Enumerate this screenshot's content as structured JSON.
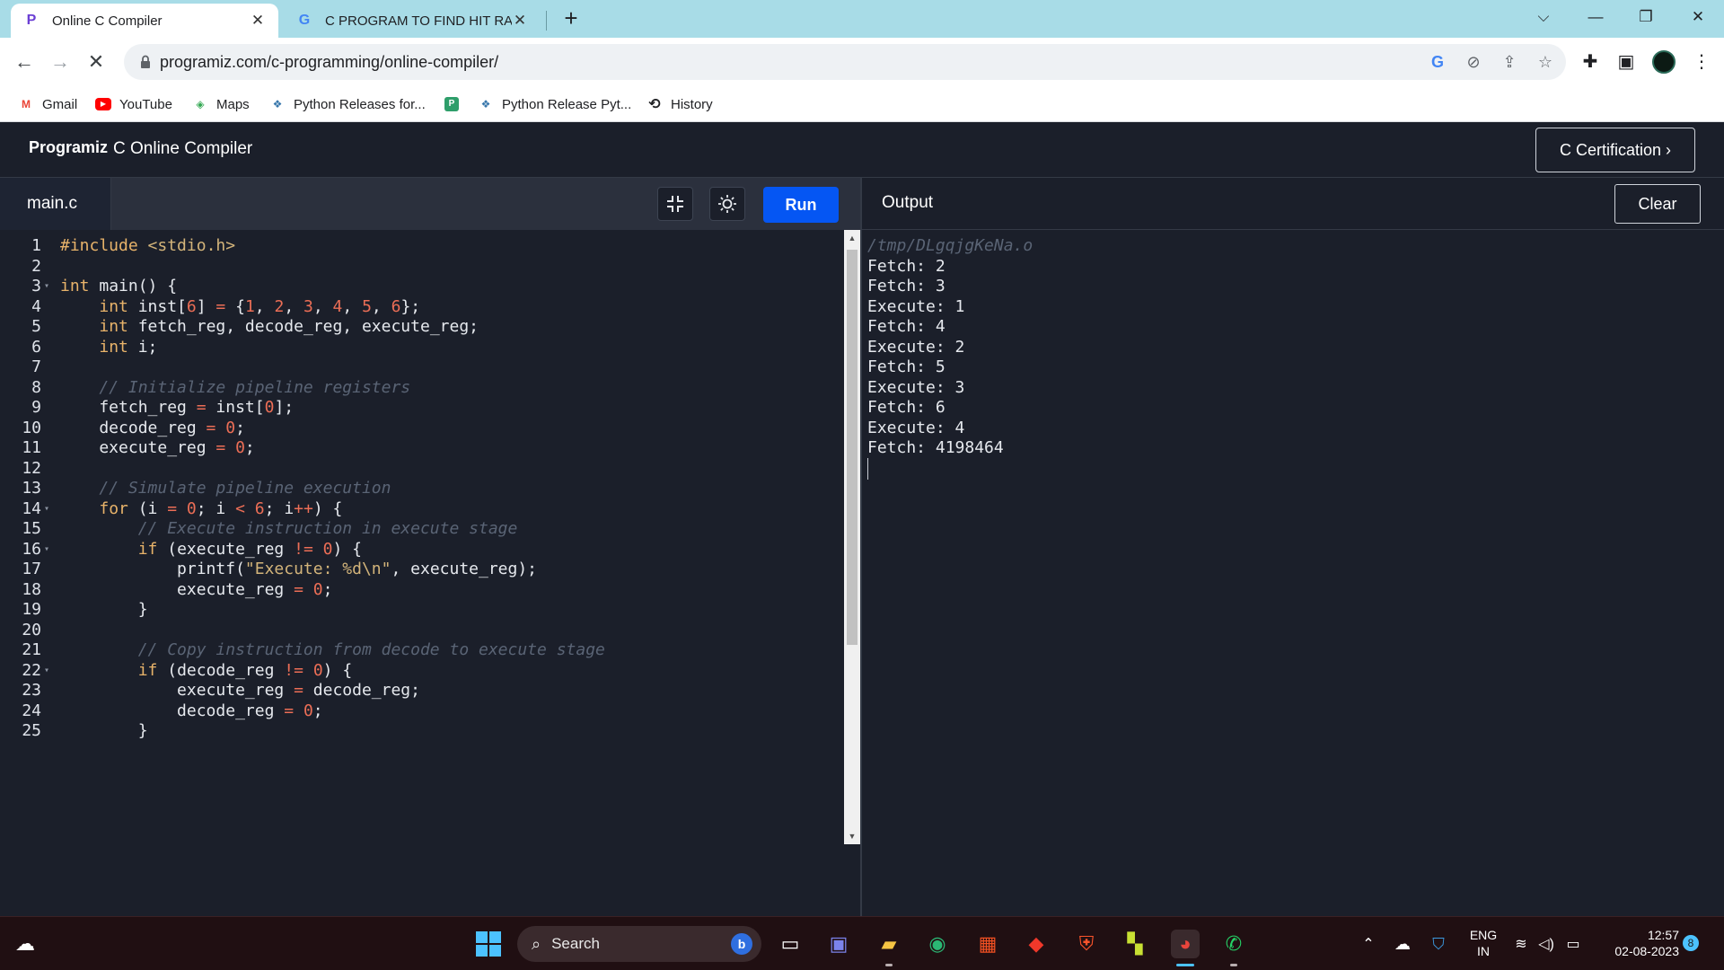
{
  "browser": {
    "tabs": [
      {
        "title": "Online C Compiler",
        "active": true
      },
      {
        "title": "C PROGRAM TO FIND HIT RATIO",
        "active": false
      }
    ],
    "url": "programiz.com/c-programming/online-compiler/",
    "bookmarks": [
      {
        "label": "Gmail",
        "icon": "gmail-icon"
      },
      {
        "label": "YouTube",
        "icon": "youtube-icon"
      },
      {
        "label": "Maps",
        "icon": "maps-icon"
      },
      {
        "label": "Python Releases for...",
        "icon": "python-icon"
      },
      {
        "label": "",
        "icon": "bookmark-p-icon"
      },
      {
        "label": "Python Release Pyt...",
        "icon": "python-icon"
      },
      {
        "label": "History",
        "icon": "history-icon"
      }
    ]
  },
  "app": {
    "logo": "Programiz",
    "title": "C Online Compiler",
    "certification_button": "C Certification ›",
    "file_name": "main.c",
    "run_label": "Run",
    "output_title": "Output",
    "clear_label": "Clear"
  },
  "editor": {
    "lines": [
      "#include <stdio.h>",
      "",
      "int main() {",
      "    int inst[6] = {1, 2, 3, 4, 5, 6};",
      "    int fetch_reg, decode_reg, execute_reg;",
      "    int i;",
      "",
      "    // Initialize pipeline registers",
      "    fetch_reg = inst[0];",
      "    decode_reg = 0;",
      "    execute_reg = 0;",
      "",
      "    // Simulate pipeline execution",
      "    for (i = 0; i < 6; i++) {",
      "        // Execute instruction in execute stage",
      "        if (execute_reg != 0) {",
      "            printf(\"Execute: %d\\n\", execute_reg);",
      "            execute_reg = 0;",
      "        }",
      "",
      "        // Copy instruction from decode to execute stage",
      "        if (decode_reg != 0) {",
      "            execute_reg = decode_reg;",
      "            decode_reg = 0;",
      "        }"
    ],
    "fold_lines": [
      3,
      14,
      16,
      22
    ]
  },
  "output": {
    "path": "/tmp/DLgqjgKeNa.o",
    "lines": [
      "Fetch: 2",
      "Fetch: 3",
      "Execute: 1",
      "Fetch: 4",
      "Execute: 2",
      "Fetch: 5",
      "Execute: 3",
      "Fetch: 6",
      "Execute: 4",
      "Fetch: 4198464"
    ]
  },
  "taskbar": {
    "search_placeholder": "Search",
    "language": "ENG",
    "region": "IN",
    "time": "12:57",
    "date": "02-08-2023",
    "notification_count": "8"
  },
  "colors": {
    "tabstrip": "#a8dce7",
    "app_bg": "#1b1f2a",
    "run_button": "#0556f3",
    "keyword": "#e8b36a",
    "number": "#ec6e56",
    "comment": "#5a6475",
    "taskbar": "#200f12"
  }
}
